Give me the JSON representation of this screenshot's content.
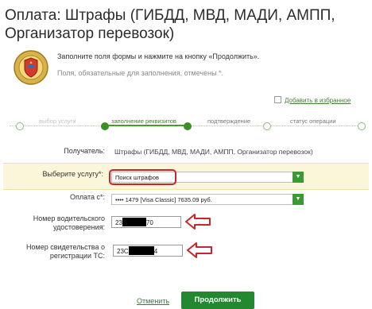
{
  "page": {
    "title": "Оплата: Штрафы (ГИБДД, МВД, МАДИ, АМПП, Организатор перевозок)",
    "intro": "Заполните поля формы и нажмите на кнопку «Продолжить».",
    "required_note": "Поля, обязательные для заполнения, отмечены *."
  },
  "favorites": {
    "label": "Добавить в избранное"
  },
  "steps": [
    {
      "label": "выбор услуги",
      "state": "done"
    },
    {
      "label": "заполнение реквизитов",
      "state": "active"
    },
    {
      "label": "подтверждение",
      "state": "pending"
    },
    {
      "label": "статус операции",
      "state": "pending"
    }
  ],
  "form": {
    "recipient_label": "Получатель:",
    "recipient_value": "Штрафы (ГИБДД, МВД, МАДИ, АМПП, Организатор перевозок)",
    "service_label": "Выберите услугу*:",
    "service_value": "Поиск штрафов",
    "payment_label": "Оплата с*:",
    "payment_value": "•••• 1479 [Visa Classic] 7635.09 руб.",
    "license_label_1": "Номер водительского",
    "license_label_2": "удостоверения:",
    "license_prefix": "23",
    "license_suffix": "70",
    "reg_label_1": "Номер свидетельства о",
    "reg_label_2": "регистрации ТС:",
    "reg_prefix": "23С",
    "reg_suffix": "4"
  },
  "actions": {
    "cancel": "Отменить",
    "continue": "Продолжить"
  },
  "colors": {
    "accent_green": "#23882f",
    "highlight_red": "#c62828",
    "band_yellow": "#fbf6d9"
  }
}
